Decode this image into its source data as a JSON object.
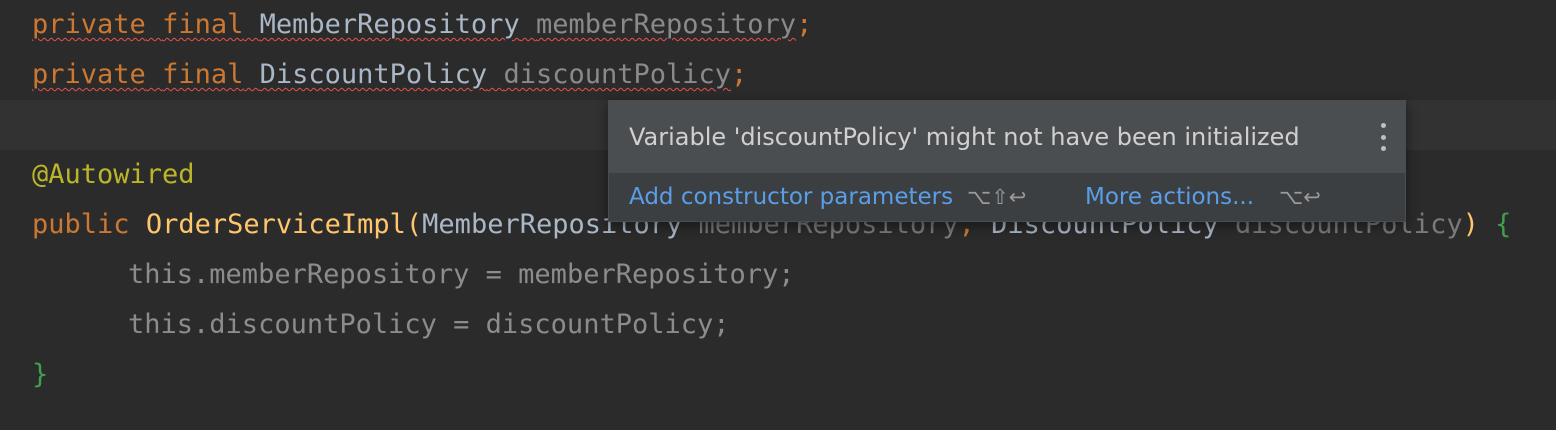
{
  "code": {
    "line1": {
      "mod1": "private",
      "mod2": "final",
      "type": "MemberRepository",
      "name": "memberRepository",
      "semi": ";"
    },
    "line2": {
      "mod1": "private",
      "mod2": "final",
      "type": "DiscountPolicy",
      "name": "discountPolicy",
      "semi": ";"
    },
    "line4": {
      "annotation": "@Autowired"
    },
    "line5": {
      "kw": "public",
      "method": "OrderServiceImpl",
      "open": "(",
      "type1": "MemberRepository",
      "param1": "memberRepository",
      "comma": ",",
      "type2": "DiscountPolicy",
      "param2": "discountPolicy",
      "close": ")",
      "brace": "{"
    },
    "line6": {
      "this": "this",
      "dot": ".",
      "field": "memberRepository",
      "eq": " = ",
      "value": "memberRepository",
      "semi": ";"
    },
    "line7": {
      "this": "this",
      "dot": ".",
      "field": "discountPolicy",
      "eq": " = ",
      "value": "discountPolicy",
      "semi": ";"
    },
    "line8": {
      "brace": "}"
    }
  },
  "popup": {
    "message": "Variable 'discountPolicy' might not have been initialized",
    "more_icon": "kebab-menu-icon",
    "actions": [
      {
        "label": "Add constructor parameters",
        "shortcut": "⌥⇧↩"
      },
      {
        "label": "More actions...",
        "shortcut": "⌥↩"
      }
    ]
  },
  "colors": {
    "background": "#2b2b2b",
    "keyword": "#cc7832",
    "method": "#ffc66d",
    "annotation": "#bbb529",
    "link": "#5a9ee8",
    "error_underline": "#e5534b"
  }
}
